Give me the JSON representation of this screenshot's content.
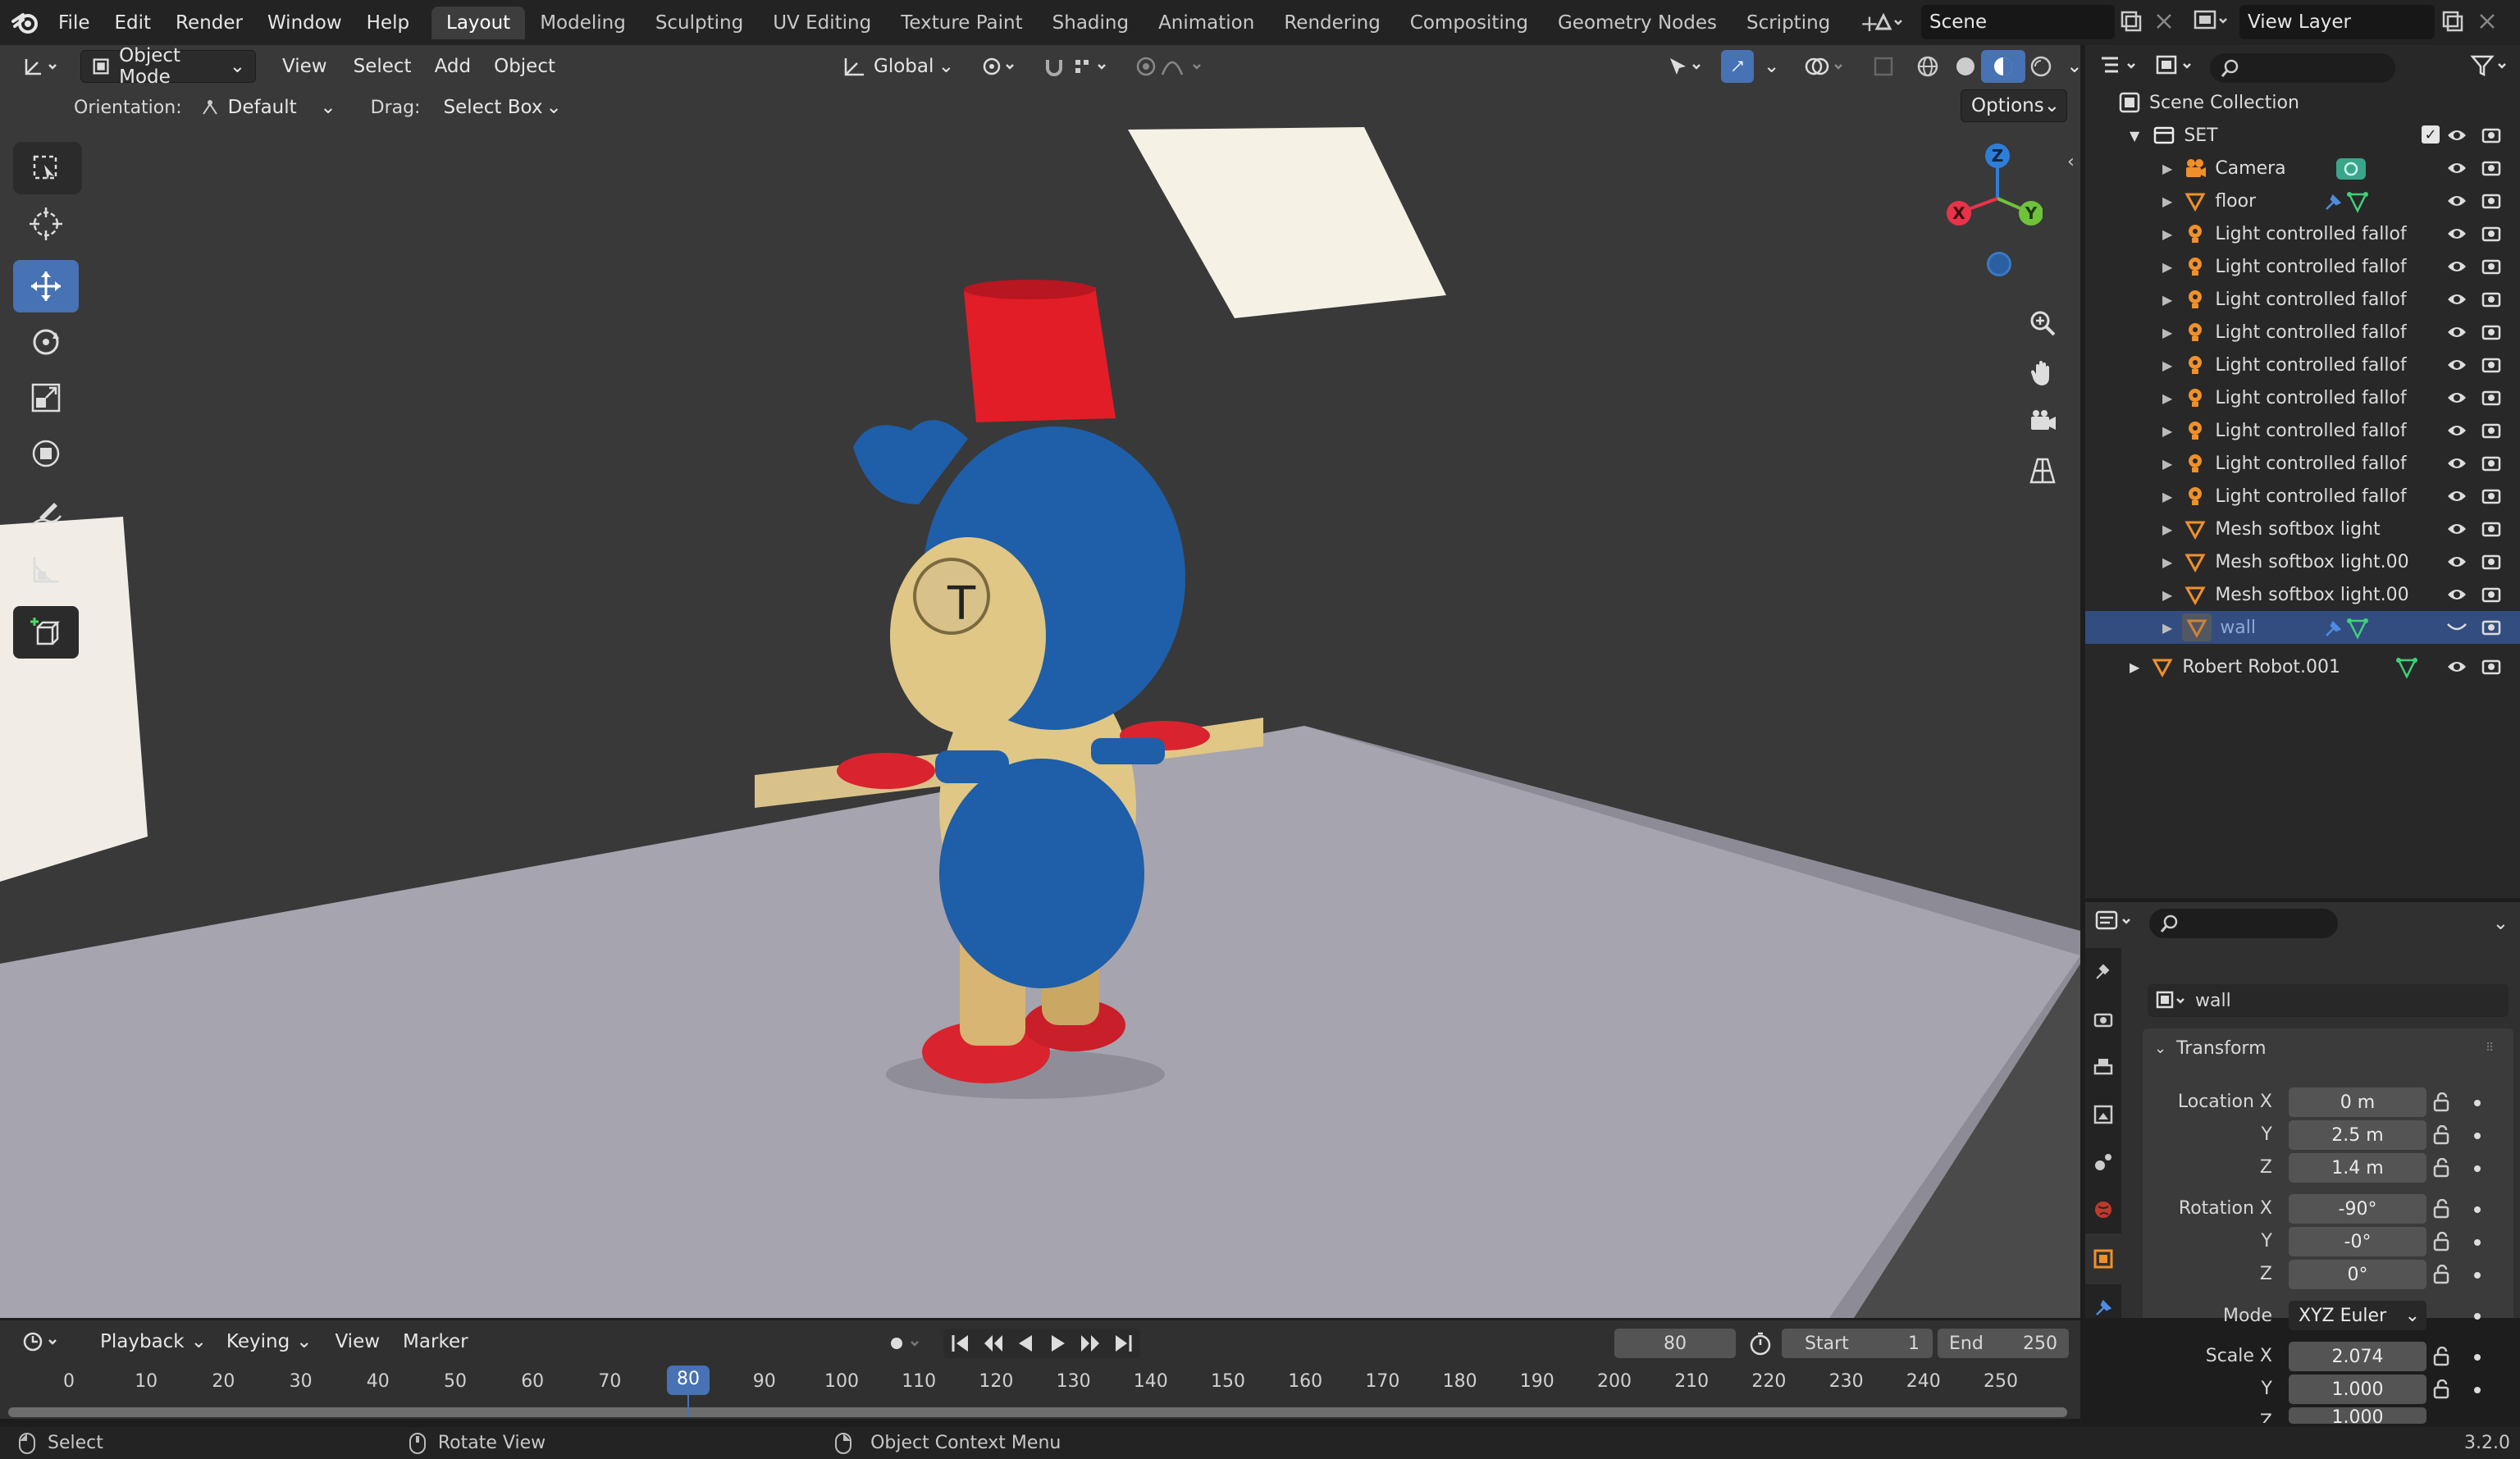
{
  "menu": [
    "File",
    "Edit",
    "Render",
    "Window",
    "Help"
  ],
  "workspaces": [
    "Layout",
    "Modeling",
    "Sculpting",
    "UV Editing",
    "Texture Paint",
    "Shading",
    "Animation",
    "Rendering",
    "Compositing",
    "Geometry Nodes",
    "Scripting"
  ],
  "active_workspace": "Layout",
  "scene_name": "Scene",
  "view_layer": "View Layer",
  "viewport_header": {
    "mode": "Object Mode",
    "menus": [
      "View",
      "Select",
      "Add",
      "Object"
    ],
    "transform_orientation": "Global",
    "orientation_label": "Orientation:",
    "orientation_value": "Default",
    "drag_label": "Drag:",
    "drag_value": "Select Box",
    "options": "Options"
  },
  "gizmo": {
    "x": "X",
    "y": "Y",
    "z": "Z"
  },
  "outliner": {
    "root": "Scene Collection",
    "collection": "SET",
    "items": [
      {
        "name": "Camera",
        "type": "camera"
      },
      {
        "name": "floor",
        "type": "mesh"
      },
      {
        "name": "Light controlled fallof",
        "type": "light"
      },
      {
        "name": "Light controlled fallof",
        "type": "light"
      },
      {
        "name": "Light controlled fallof",
        "type": "light"
      },
      {
        "name": "Light controlled fallof",
        "type": "light"
      },
      {
        "name": "Light controlled fallof",
        "type": "light"
      },
      {
        "name": "Light controlled fallof",
        "type": "light"
      },
      {
        "name": "Light controlled fallof",
        "type": "light"
      },
      {
        "name": "Light controlled fallof",
        "type": "light"
      },
      {
        "name": "Light controlled fallof",
        "type": "light"
      },
      {
        "name": "Mesh softbox light",
        "type": "mesh"
      },
      {
        "name": "Mesh softbox light.00",
        "type": "mesh"
      },
      {
        "name": "Mesh softbox light.00",
        "type": "mesh"
      },
      {
        "name": "wall",
        "type": "mesh",
        "selected": true
      }
    ],
    "top_level": "Robert Robot.001"
  },
  "properties": {
    "object_name": "wall",
    "panel": "Transform",
    "location": {
      "label": "Location X",
      "x": "0 m",
      "y": "2.5 m",
      "z": "1.4 m"
    },
    "rotation": {
      "label": "Rotation X",
      "x": "-90°",
      "y": "-0°",
      "z": "0°"
    },
    "mode_label": "Mode",
    "mode": "XYZ Euler",
    "scale": {
      "label": "Scale X",
      "x": "2.074",
      "y": "1.000",
      "z": "1.000"
    },
    "axis_y": "Y",
    "axis_z": "Z"
  },
  "timeline": {
    "menus": [
      "Playback",
      "Keying",
      "View",
      "Marker"
    ],
    "current_frame": "80",
    "start_label": "Start",
    "start": "1",
    "end_label": "End",
    "end": "250",
    "ticks": [
      "0",
      "10",
      "20",
      "30",
      "40",
      "50",
      "60",
      "70",
      "80",
      "90",
      "100",
      "110",
      "120",
      "130",
      "140",
      "150",
      "160",
      "170",
      "180",
      "190",
      "200",
      "210",
      "220",
      "230",
      "240",
      "250"
    ]
  },
  "status": {
    "select": "Select",
    "rotate": "Rotate View",
    "context": "Object Context Menu",
    "version": "3.2.0"
  },
  "colors": {
    "accent": "#4772b3",
    "selection": "#334d80"
  }
}
